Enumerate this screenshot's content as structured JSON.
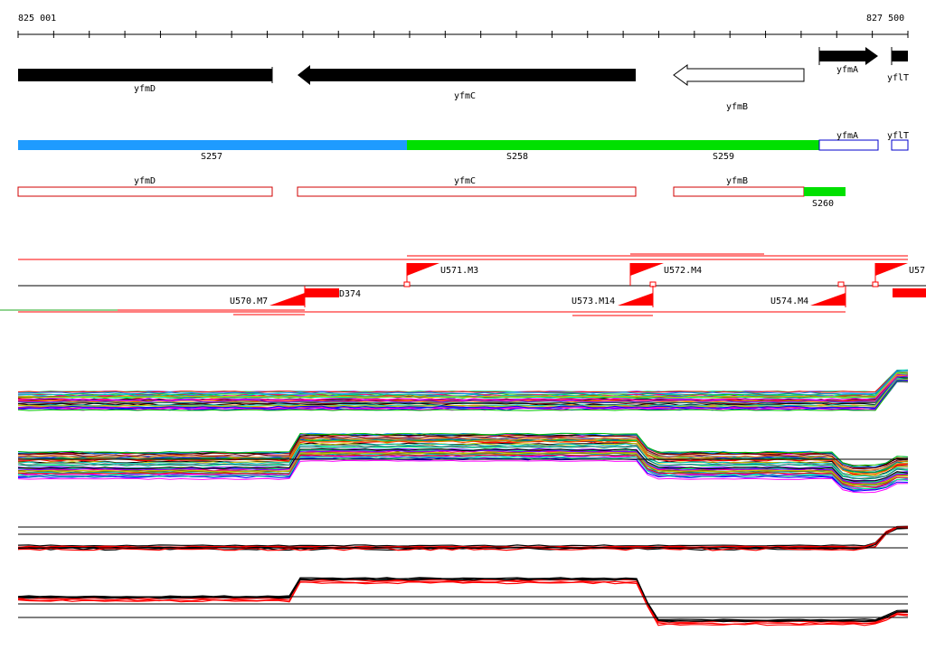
{
  "coords": {
    "start": "825 001",
    "end": "827 500"
  },
  "genes": [
    {
      "name": "yfmD",
      "strand": "-",
      "fill": "#000000"
    },
    {
      "name": "yfmC",
      "strand": "-",
      "fill": "#000000"
    },
    {
      "name": "yfmB",
      "strand": "-",
      "fill": "#ffffff"
    },
    {
      "name": "yfmA",
      "strand": "+",
      "fill": "#000000"
    },
    {
      "name": "yflT",
      "strand": "+",
      "fill": "#000000"
    }
  ],
  "segments": [
    {
      "name": "S257",
      "color": "#1e9bff"
    },
    {
      "name": "S258",
      "color": "#00e000"
    },
    {
      "name": "S259",
      "color": "#00e000"
    },
    {
      "name": "yfmA",
      "color": "#0000cc"
    },
    {
      "name": "yflT",
      "color": "#0000cc"
    }
  ],
  "transcripts": [
    {
      "name": "yfmD"
    },
    {
      "name": "yfmC"
    },
    {
      "name": "yfmB"
    },
    {
      "name": "S260",
      "color": "#00e000"
    }
  ],
  "promoters_top": [
    "U571.M3",
    "U572.M4",
    "U57"
  ],
  "promoters_bottom": [
    "U570.M7",
    "U573.M14",
    "U574.M4"
  ],
  "terminator": "D374",
  "colors": {
    "accent": "#ff0000",
    "line": "#000000"
  }
}
